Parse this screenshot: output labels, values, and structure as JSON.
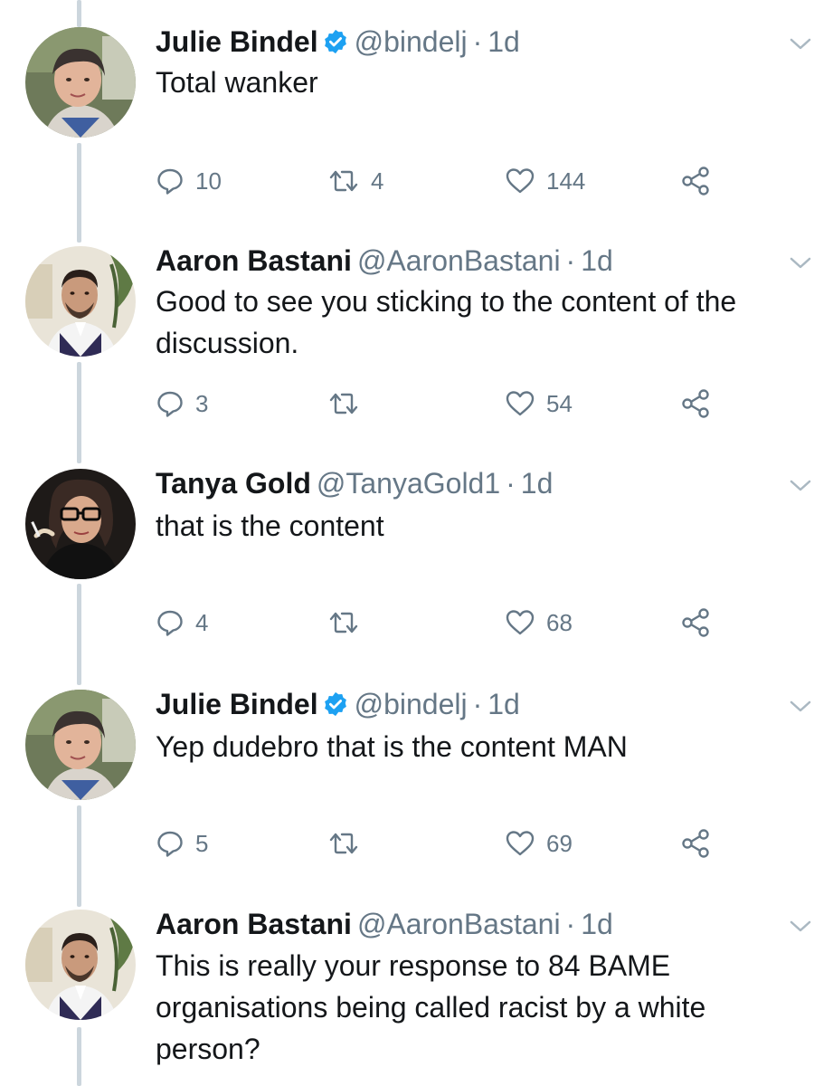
{
  "tweets": [
    {
      "name": "Julie Bindel",
      "handle": "@bindelj",
      "dot": "·",
      "time": "1d",
      "verified": true,
      "text": "Total wanker",
      "replies": "10",
      "retweets": "4",
      "likes": "144"
    },
    {
      "name": "Aaron Bastani",
      "handle": "@AaronBastani",
      "dot": "·",
      "time": "1d",
      "verified": false,
      "text": "Good to see you sticking to the content of the discussion.",
      "replies": "3",
      "retweets": "",
      "likes": "54"
    },
    {
      "name": "Tanya Gold",
      "handle": "@TanyaGold1",
      "dot": "·",
      "time": "1d",
      "verified": false,
      "text": "that is the content",
      "replies": "4",
      "retweets": "",
      "likes": "68"
    },
    {
      "name": "Julie Bindel",
      "handle": "@bindelj",
      "dot": "·",
      "time": "1d",
      "verified": true,
      "text": "Yep dudebro that is the content MAN",
      "replies": "5",
      "retweets": "",
      "likes": "69"
    },
    {
      "name": "Aaron Bastani",
      "handle": "@AaronBastani",
      "dot": "·",
      "time": "1d",
      "verified": false,
      "text": "This is really your response to 84 BAME organisations being called racist by a white person?",
      "replies": "",
      "retweets": "",
      "likes": ""
    }
  ],
  "colors": {
    "text": "#14171a",
    "secondary": "#657786",
    "thread_line": "#ccd6dd",
    "verified": "#1da1f2"
  },
  "icons": {
    "reply": "reply-icon",
    "retweet": "retweet-icon",
    "like": "heart-icon",
    "share": "share-icon",
    "more": "chevron-down-icon",
    "verified": "verified-badge-icon"
  }
}
